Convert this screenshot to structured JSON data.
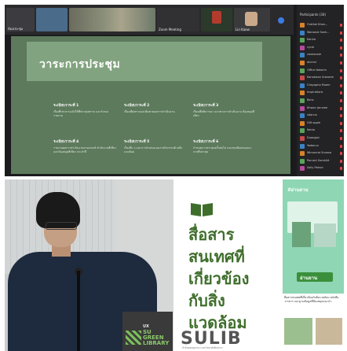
{
  "zoom": {
    "participants_title": "Participants (34)",
    "thumbnails": [
      {
        "label": "ห้องประชุม"
      },
      {
        "label": ""
      },
      {
        "label": ""
      },
      {
        "label": "Zoom Meeting"
      },
      {
        "label": ""
      },
      {
        "label": "Lin Kaew"
      }
    ],
    "participants": [
      {
        "name": "Orathai Khon...",
        "color": "#d9822b"
      },
      {
        "name": "Worawut Sonk...",
        "color": "#3b82c4"
      },
      {
        "name": "Kanha",
        "color": "#5aa35a"
      },
      {
        "name": "cycle",
        "color": "#b44a9c"
      },
      {
        "name": "cashocash",
        "color": "#3b82c4"
      },
      {
        "name": "alumni",
        "color": "#d9822b"
      },
      {
        "name": "Office Nakarin",
        "color": "#5aa35a"
      },
      {
        "name": "Kanokwan Sukserm",
        "color": "#c44a4a"
      },
      {
        "name": "Chayapha Muem",
        "color": "#3b82c4"
      },
      {
        "name": "Inspirations",
        "color": "#d9822b"
      },
      {
        "name": "Benz",
        "color": "#5aa35a"
      },
      {
        "name": "Khwan Jarunee",
        "color": "#b44a9c"
      },
      {
        "name": "sitanun",
        "color": "#3b82c4"
      },
      {
        "name": "Gift apple",
        "color": "#d9822b"
      },
      {
        "name": "Kenta",
        "color": "#5aa35a"
      },
      {
        "name": "Duangjai",
        "color": "#c44a4a"
      },
      {
        "name": "Yadanun",
        "color": "#3b82c4"
      },
      {
        "name": "Wimonrat Sunesa",
        "color": "#d9822b"
      },
      {
        "name": "Pornsiri Somkhit",
        "color": "#5aa35a"
      },
      {
        "name": "Sally Patron",
        "color": "#b44a9c"
      }
    ],
    "slide": {
      "title": "วาระการประชุม",
      "agenda": [
        {
          "heading": "ระเบียบวาระที่ 1",
          "body": "เรื่องที่ประธานแจ้งให้ที่ประชุมทราบ และรับรองรายงาน"
        },
        {
          "heading": "ระเบียบวาระที่ 2",
          "body": "เรื่องเพื่อทราบและติดตามผลการดำเนินงาน"
        },
        {
          "heading": "ระเบียบวาระที่ 3",
          "body": "เรื่องเพื่อพิจารณา แนวทางการดำเนินงาน ห้องสมุดสีเขียว"
        },
        {
          "heading": "ระเบียบวาระที่ 4",
          "body": "รายงานผลการดำเนินงานตามเกณฑ์ สำนักงานสีเขียวและห้องสมุดสีเขียว ประจำปี"
        },
        {
          "heading": "ระเบียบวาระที่ 5",
          "body": "เรื่องอื่น ๆ และการนำเสนอ ผลงานกิจกรรมด้านสิ่งแวดล้อม"
        },
        {
          "heading": "ระเบียบวาระที่ 6",
          "body": "กำหนดการประชุมครั้งต่อไป และสรุปข้อเสนอแนะจากที่ประชุม"
        }
      ]
    }
  },
  "photo": {
    "sticker_small": "SU\nGREEN\nLIBRARY",
    "sticker_mark": "UX"
  },
  "poster": {
    "lines": [
      "สื่อสาร",
      "สนเทศที่",
      "เกี่ยวข้อง",
      "กับสิ่ง",
      "แวดล้อม"
    ],
    "brand": "SULIB",
    "brand_sub": "สำนักหอสมุดกลาง มหาวิทยาลัยศิลปากร",
    "card_title": "#อ่านยาน",
    "card_tag": "อ่านยาน",
    "card_caption": "สื่อสารสนเทศที่เกี่ยวข้องกับสิ่งแวดล้อม หนังสือ วารสาร และฐานข้อมูลที่ห้องสมุดแนะนำ"
  },
  "colors": {
    "slide_bg": "#5d7a5c",
    "slide_head": "#82a37f",
    "poster_green": "#3f6e2c",
    "card_green": "#8fd6b4"
  }
}
